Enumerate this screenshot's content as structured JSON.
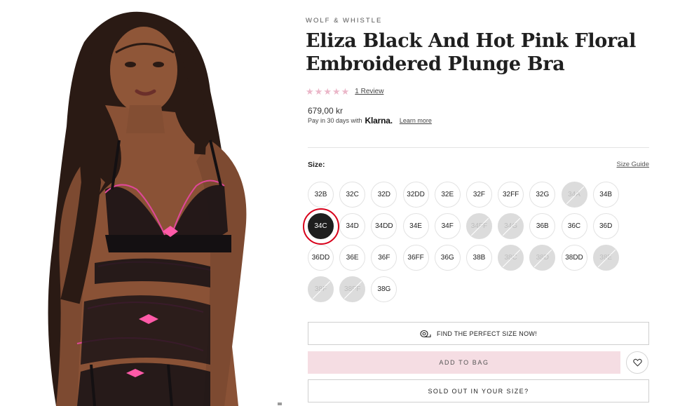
{
  "product": {
    "brand": "WOLF & WHISTLE",
    "title": "Eliza Black And Hot Pink Floral Embroidered Plunge Bra",
    "rating_stars": 5,
    "review_link": "1 Review",
    "price": "679,00 kr",
    "klarna_text": "Pay in 30 days with",
    "klarna_logo": "Klarna.",
    "learn_more": "Learn more"
  },
  "size_section": {
    "label": "Size:",
    "guide_link": "Size Guide",
    "selected": "34C",
    "sizes": [
      {
        "label": "32B",
        "available": true
      },
      {
        "label": "32C",
        "available": true
      },
      {
        "label": "32D",
        "available": true
      },
      {
        "label": "32DD",
        "available": true
      },
      {
        "label": "32E",
        "available": true
      },
      {
        "label": "32F",
        "available": true
      },
      {
        "label": "32FF",
        "available": true
      },
      {
        "label": "32G",
        "available": true
      },
      {
        "label": "34A",
        "available": false
      },
      {
        "label": "34B",
        "available": true
      },
      {
        "label": "34C",
        "available": true
      },
      {
        "label": "34D",
        "available": true
      },
      {
        "label": "34DD",
        "available": true
      },
      {
        "label": "34E",
        "available": true
      },
      {
        "label": "34F",
        "available": true
      },
      {
        "label": "34FF",
        "available": false
      },
      {
        "label": "34G",
        "available": false
      },
      {
        "label": "36B",
        "available": true
      },
      {
        "label": "36C",
        "available": true
      },
      {
        "label": "36D",
        "available": true
      },
      {
        "label": "36DD",
        "available": true
      },
      {
        "label": "36E",
        "available": true
      },
      {
        "label": "36F",
        "available": true
      },
      {
        "label": "36FF",
        "available": true
      },
      {
        "label": "36G",
        "available": true
      },
      {
        "label": "38B",
        "available": true
      },
      {
        "label": "38C",
        "available": false
      },
      {
        "label": "38D",
        "available": false
      },
      {
        "label": "38DD",
        "available": true
      },
      {
        "label": "38E",
        "available": false
      },
      {
        "label": "38F",
        "available": false
      },
      {
        "label": "38FF",
        "available": false
      },
      {
        "label": "38G",
        "available": true
      }
    ]
  },
  "actions": {
    "find_size": "FIND THE PERFECT SIZE NOW!",
    "add_to_bag": "ADD TO BAG",
    "sold_out": "SOLD OUT IN YOUR SIZE?"
  },
  "colors": {
    "star": "#ebb7c9",
    "bag_button": "#f5dde3",
    "selected_size": "#1e1e1e",
    "highlight_ring": "#d8001a",
    "sold_out_size": "#dcdcdc",
    "embroidery_pink": "#e0479a"
  },
  "icons": {
    "wishlist": "heart-icon",
    "find_size": "tape-measure-icon",
    "rating": "star-icon"
  }
}
